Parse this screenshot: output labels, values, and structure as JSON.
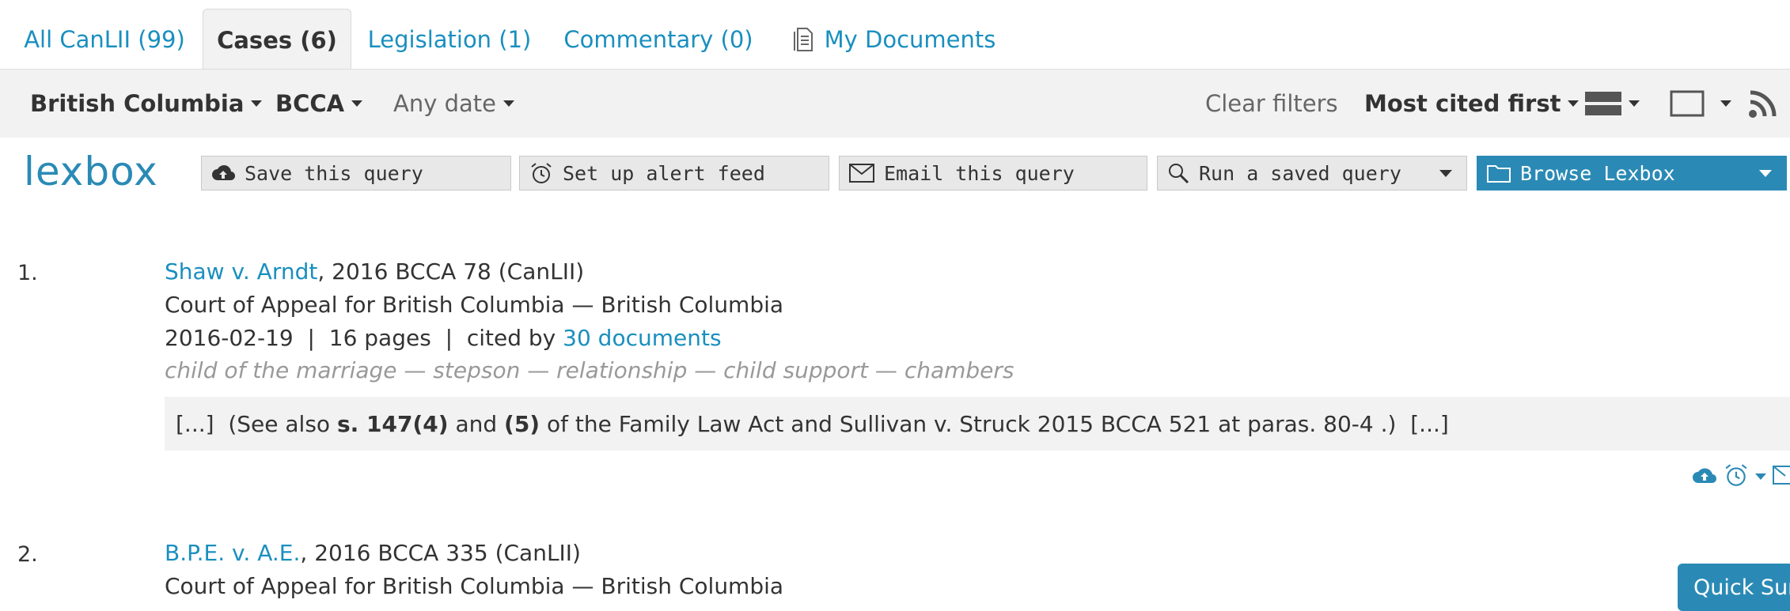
{
  "tabs": [
    {
      "label": "All CanLII (99)",
      "active": false
    },
    {
      "label": "Cases (6)",
      "active": true
    },
    {
      "label": "Legislation (1)",
      "active": false
    },
    {
      "label": "Commentary (0)",
      "active": false
    },
    {
      "label": "My Documents",
      "active": false,
      "icon": "document-icon"
    }
  ],
  "filters": {
    "jurisdiction": "British Columbia",
    "court": "BCCA",
    "date": "Any date",
    "clear": "Clear filters",
    "sort": "Most cited first"
  },
  "lexbox": {
    "logo": "lexbox",
    "save": "Save this query",
    "alert": "Set up alert feed",
    "email": "Email this query",
    "run": "Run a saved query",
    "browse": "Browse Lexbox"
  },
  "results": [
    {
      "number": "1.",
      "title": "Shaw v. Arndt",
      "citation": ", 2016 BCCA 78 (CanLII)",
      "court": "Court of Appeal for British Columbia — British Columbia",
      "meta_prefix": "2016-02-19  |  16 pages  |  cited by ",
      "cited_by": "30 documents",
      "keywords": "child of the marriage — stepson — relationship — child support — chambers",
      "excerpt": {
        "a": "[...]  (See also ",
        "b": "s. 147(4)",
        "c": " and ",
        "d": "(5)",
        "e": " of the Family Law Act and Sullivan v. Struck 2015 BCCA 521 at paras. 80-4 .)  [...]"
      }
    },
    {
      "number": "2.",
      "title": "B.P.E. v. A.E.",
      "citation": ", 2016 BCCA 335 (CanLII)",
      "court": "Court of Appeal for British Columbia — British Columbia"
    }
  ],
  "quick_summary": "Quick Sum",
  "colors": {
    "accent": "#2a8ab5",
    "link": "#1a8fbf",
    "bar": "#f2f2f2"
  }
}
